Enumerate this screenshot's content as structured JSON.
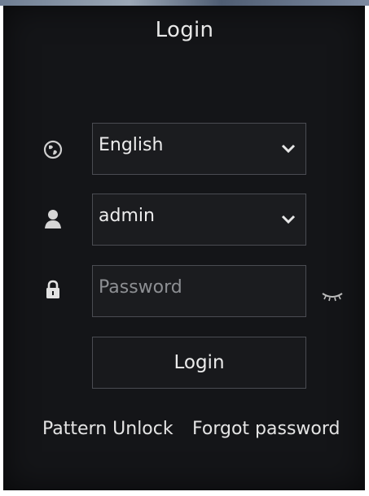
{
  "dialog": {
    "title": "Login"
  },
  "language": {
    "value": "English",
    "icon": "globe-icon"
  },
  "username": {
    "value": "admin",
    "icon": "user-icon"
  },
  "password": {
    "placeholder": "Password",
    "icon": "lock-icon",
    "toggle_icon": "eye-icon"
  },
  "login_button": {
    "label": "Login"
  },
  "links": {
    "pattern_unlock": "Pattern Unlock",
    "forgot_password": "Forgot password"
  }
}
